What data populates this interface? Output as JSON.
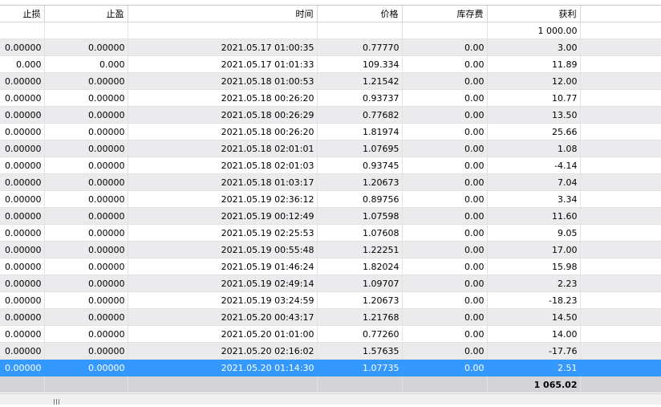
{
  "columns": [
    "止损",
    "止盈",
    "时间",
    "价格",
    "库存费",
    "获利"
  ],
  "balance_row": {
    "profit": "1 000.00"
  },
  "rows": [
    {
      "sl": "0.00000",
      "tp": "0.00000",
      "time": "2021.05.17 01:00:35",
      "price": "0.77770",
      "swap": "0.00",
      "profit": "3.00"
    },
    {
      "sl": "0.000",
      "tp": "0.000",
      "time": "2021.05.17 01:01:33",
      "price": "109.334",
      "swap": "0.00",
      "profit": "11.89"
    },
    {
      "sl": "0.00000",
      "tp": "0.00000",
      "time": "2021.05.18 01:00:53",
      "price": "1.21542",
      "swap": "0.00",
      "profit": "12.00"
    },
    {
      "sl": "0.00000",
      "tp": "0.00000",
      "time": "2021.05.18 00:26:20",
      "price": "0.93737",
      "swap": "0.00",
      "profit": "10.77"
    },
    {
      "sl": "0.00000",
      "tp": "0.00000",
      "time": "2021.05.18 00:26:29",
      "price": "0.77682",
      "swap": "0.00",
      "profit": "13.50"
    },
    {
      "sl": "0.00000",
      "tp": "0.00000",
      "time": "2021.05.18 00:26:20",
      "price": "1.81974",
      "swap": "0.00",
      "profit": "25.66"
    },
    {
      "sl": "0.00000",
      "tp": "0.00000",
      "time": "2021.05.18 02:01:01",
      "price": "1.07695",
      "swap": "0.00",
      "profit": "1.08"
    },
    {
      "sl": "0.00000",
      "tp": "0.00000",
      "time": "2021.05.18 02:01:03",
      "price": "0.93745",
      "swap": "0.00",
      "profit": "-4.14"
    },
    {
      "sl": "0.00000",
      "tp": "0.00000",
      "time": "2021.05.18 01:03:17",
      "price": "1.20673",
      "swap": "0.00",
      "profit": "7.04"
    },
    {
      "sl": "0.00000",
      "tp": "0.00000",
      "time": "2021.05.19 02:36:12",
      "price": "0.89756",
      "swap": "0.00",
      "profit": "3.34"
    },
    {
      "sl": "0.00000",
      "tp": "0.00000",
      "time": "2021.05.19 00:12:49",
      "price": "1.07598",
      "swap": "0.00",
      "profit": "11.60"
    },
    {
      "sl": "0.00000",
      "tp": "0.00000",
      "time": "2021.05.19 02:25:53",
      "price": "1.07608",
      "swap": "0.00",
      "profit": "9.05"
    },
    {
      "sl": "0.00000",
      "tp": "0.00000",
      "time": "2021.05.19 00:55:48",
      "price": "1.22251",
      "swap": "0.00",
      "profit": "17.00"
    },
    {
      "sl": "0.00000",
      "tp": "0.00000",
      "time": "2021.05.19 01:46:24",
      "price": "1.82024",
      "swap": "0.00",
      "profit": "15.98"
    },
    {
      "sl": "0.00000",
      "tp": "0.00000",
      "time": "2021.05.19 02:49:14",
      "price": "1.09707",
      "swap": "0.00",
      "profit": "2.23"
    },
    {
      "sl": "0.00000",
      "tp": "0.00000",
      "time": "2021.05.19 03:24:59",
      "price": "1.20673",
      "swap": "0.00",
      "profit": "-18.23"
    },
    {
      "sl": "0.00000",
      "tp": "0.00000",
      "time": "2021.05.20 00:43:17",
      "price": "1.21768",
      "swap": "0.00",
      "profit": "14.50"
    },
    {
      "sl": "0.00000",
      "tp": "0.00000",
      "time": "2021.05.20 01:01:00",
      "price": "0.77260",
      "swap": "0.00",
      "profit": "14.00"
    },
    {
      "sl": "0.00000",
      "tp": "0.00000",
      "time": "2021.05.20 02:16:02",
      "price": "1.57635",
      "swap": "0.00",
      "profit": "-17.76"
    },
    {
      "sl": "0.00000",
      "tp": "0.00000",
      "time": "2021.05.20 01:14:30",
      "price": "1.07735",
      "swap": "0.00",
      "profit": "2.51",
      "selected": true
    }
  ],
  "total_row": {
    "profit": "1 065.02"
  },
  "colors": {
    "selection": "#3399ff",
    "stripe": "#ebebee",
    "totals": "#d4d4d8"
  }
}
